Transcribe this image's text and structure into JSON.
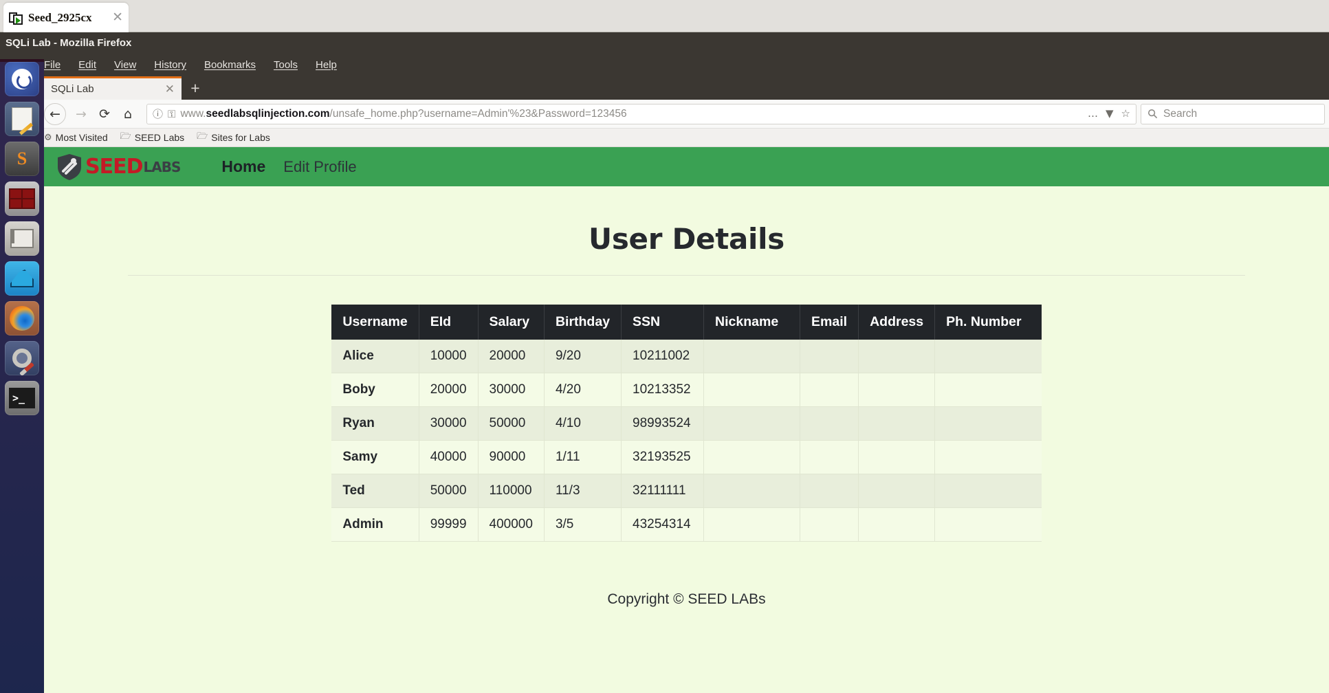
{
  "vm": {
    "tab_title": "Seed_2925cx",
    "tab_close": "✕",
    "tab_icon": "vm-window-icon"
  },
  "firefox": {
    "window_title": "SQLi Lab - Mozilla Firefox",
    "menu": [
      "File",
      "Edit",
      "View",
      "History",
      "Bookmarks",
      "Tools",
      "Help"
    ],
    "tab_label": "SQLi Lab",
    "tab_close": "✕",
    "new_tab": "+",
    "nav": {
      "back": "←",
      "forward": "→",
      "reload": "⟳",
      "home": "⌂"
    },
    "url": {
      "info_icon": "ⓘ",
      "key_icon": "⚿",
      "prefix": "www.",
      "host": "seedlabsqlinjection.com",
      "path": "/unsafe_home.php?username=Admin'%23&Password=123456",
      "full": "www.seedlabsqlinjection.com/unsafe_home.php?username=Admin'%23&Password=123456",
      "overflow_icon": "…",
      "pocket_icon": "▼",
      "bookmark_icon": "☆"
    },
    "search": {
      "icon": "ὐd",
      "placeholder": "Search",
      "value": ""
    },
    "bookmarks": [
      {
        "icon": "⚙",
        "label": "Most Visited"
      },
      {
        "icon": "὜0",
        "label": "SEED Labs"
      },
      {
        "icon": "὜0",
        "label": "Sites for Labs"
      }
    ]
  },
  "launcher": {
    "items": [
      {
        "name": "ubuntu-dash-icon",
        "label": "Ubuntu Dash"
      },
      {
        "name": "text-editor-icon",
        "label": "Text Editor"
      },
      {
        "name": "sublime-text-icon",
        "label": "Sublime Text"
      },
      {
        "name": "terminator-icon",
        "label": "Terminator"
      },
      {
        "name": "file-manager-icon",
        "label": "Files"
      },
      {
        "name": "wireshark-icon",
        "label": "Wireshark"
      },
      {
        "name": "firefox-icon",
        "label": "Firefox"
      },
      {
        "name": "system-settings-icon",
        "label": "System Settings"
      },
      {
        "name": "terminal-icon",
        "label": "Terminal"
      }
    ],
    "sublime_glyph": "S",
    "terminal_glyph": ">_"
  },
  "site": {
    "brand": {
      "seed": "SEED",
      "labs": "LABS"
    },
    "nav": [
      {
        "label": "Home",
        "active": true
      },
      {
        "label": "Edit Profile",
        "active": false
      }
    ],
    "heading": "User Details",
    "copyright": "Copyright © SEED LABs"
  },
  "table": {
    "columns": [
      "Username",
      "EId",
      "Salary",
      "Birthday",
      "SSN",
      "Nickname",
      "Email",
      "Address",
      "Ph. Number"
    ],
    "rows": [
      {
        "username": "Alice",
        "eid": "10000",
        "salary": "20000",
        "birthday": "9/20",
        "ssn": "10211002",
        "nickname": "",
        "email": "",
        "address": "",
        "phone": ""
      },
      {
        "username": "Boby",
        "eid": "20000",
        "salary": "30000",
        "birthday": "4/20",
        "ssn": "10213352",
        "nickname": "",
        "email": "",
        "address": "",
        "phone": ""
      },
      {
        "username": "Ryan",
        "eid": "30000",
        "salary": "50000",
        "birthday": "4/10",
        "ssn": "98993524",
        "nickname": "",
        "email": "",
        "address": "",
        "phone": ""
      },
      {
        "username": "Samy",
        "eid": "40000",
        "salary": "90000",
        "birthday": "1/11",
        "ssn": "32193525",
        "nickname": "",
        "email": "",
        "address": "",
        "phone": ""
      },
      {
        "username": "Ted",
        "eid": "50000",
        "salary": "110000",
        "birthday": "11/3",
        "ssn": "32111111",
        "nickname": "",
        "email": "",
        "address": "",
        "phone": ""
      },
      {
        "username": "Admin",
        "eid": "99999",
        "salary": "400000",
        "birthday": "3/5",
        "ssn": "43254314",
        "nickname": "",
        "email": "",
        "address": "",
        "phone": ""
      }
    ]
  },
  "colors": {
    "navbar_green": "#3aa153",
    "page_bg": "#f2fbe0",
    "table_header_bg": "#222529",
    "row_odd": "#e8eedb",
    "row_even": "#f4fbe6",
    "firefox_chrome": "#3b3732",
    "tab_accent": "#e06d17"
  }
}
